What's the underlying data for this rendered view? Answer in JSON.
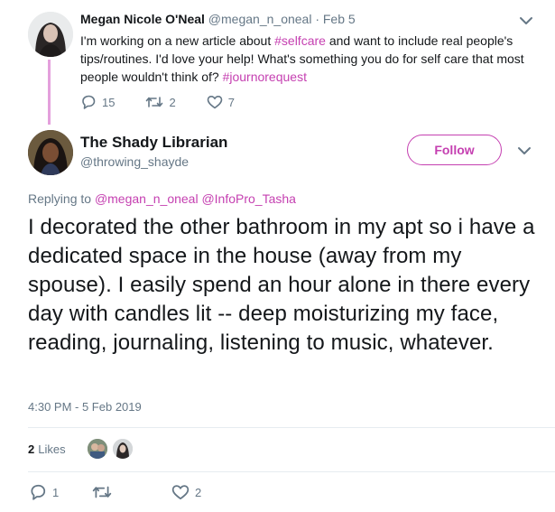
{
  "parent_tweet": {
    "name": "Megan Nicole O'Neal",
    "meta": " @megan_n_oneal · Feb 5",
    "text_parts": [
      "I'm working on a new article about ",
      "#selfcare",
      " and want to include real people's tips/routines. I'd love your help! What's something you do for self care that most people wouldn't think of? ",
      "#journorequest"
    ],
    "replies": "15",
    "retweets": "2",
    "likes": "7"
  },
  "main_tweet": {
    "name": "The Shady Librarian",
    "handle": "@throwing_shayde",
    "follow_label": "Follow",
    "replying_prefix": "Replying to ",
    "replying_to": "@megan_n_oneal @InfoPro_Tasha",
    "text": "I decorated the other bathroom in my apt so i have a dedicated space in the house (away from my spouse). I easily spend an hour alone in there every day with candles lit -- deep moisturizing my face, reading, journaling, listening to music, whatever.",
    "timestamp": "4:30 PM - 5 Feb 2019",
    "likes_count": "2",
    "likes_label": "Likes",
    "replies": "1",
    "retweets": "",
    "likes": "2"
  },
  "icons": [
    "reply-icon",
    "retweet-icon",
    "heart-icon",
    "chevron-down-icon"
  ],
  "colors": {
    "accent": "#c540b1",
    "muted": "#657786",
    "text": "#14171a"
  }
}
